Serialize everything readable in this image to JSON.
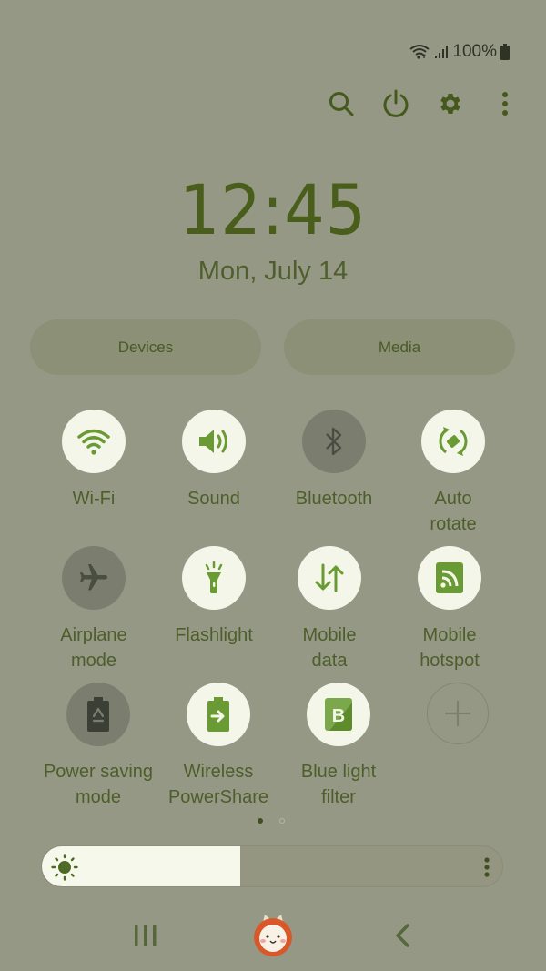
{
  "status_bar": {
    "wifi_icon": "wifi-icon",
    "signal_icon": "signal-icon",
    "battery_text": "100%",
    "battery_icon": "battery-full-icon"
  },
  "top_actions": [
    {
      "name": "search",
      "icon": "search-icon"
    },
    {
      "name": "power",
      "icon": "power-icon"
    },
    {
      "name": "settings",
      "icon": "gear-icon"
    },
    {
      "name": "more",
      "icon": "more-vertical-icon"
    }
  ],
  "clock": {
    "time": "12:45",
    "date": "Mon, July 14"
  },
  "pills": {
    "devices": "Devices",
    "media": "Media"
  },
  "tiles": [
    {
      "label": "Wi-Fi",
      "state": "on",
      "icon": "wifi-icon"
    },
    {
      "label": "Sound",
      "state": "on",
      "icon": "sound-icon"
    },
    {
      "label": "Bluetooth",
      "state": "off",
      "icon": "bluetooth-icon"
    },
    {
      "label": "Auto\nrotate",
      "state": "on",
      "icon": "auto-rotate-icon"
    },
    {
      "label": "Airplane\nmode",
      "state": "off",
      "icon": "airplane-icon"
    },
    {
      "label": "Flashlight",
      "state": "on",
      "icon": "flashlight-icon"
    },
    {
      "label": "Mobile\ndata",
      "state": "on",
      "icon": "mobile-data-icon"
    },
    {
      "label": "Mobile\nhotspot",
      "state": "on",
      "icon": "hotspot-icon"
    },
    {
      "label": "Power saving\nmode",
      "state": "off",
      "icon": "power-saving-icon"
    },
    {
      "label": "Wireless\nPowerShare",
      "state": "on",
      "icon": "wireless-powershare-icon"
    },
    {
      "label": "Blue light\nfilter",
      "state": "on",
      "icon": "blue-light-filter-icon"
    },
    {
      "label": "",
      "state": "add",
      "icon": "plus-icon"
    }
  ],
  "page_indicator": {
    "current": 1,
    "total": 2
  },
  "brightness": {
    "level_percent": 43,
    "icon": "sun-icon",
    "more_icon": "more-vertical-icon"
  },
  "navbar": {
    "recents": "recents-icon",
    "home": "home-mascot-icon",
    "back": "back-icon"
  },
  "colors": {
    "background": "#969886",
    "accent_green": "#6a9a34",
    "text_green": "#4d5e2b",
    "tile_on": "#f3f6e8",
    "tile_off": "#7b7e6f"
  }
}
